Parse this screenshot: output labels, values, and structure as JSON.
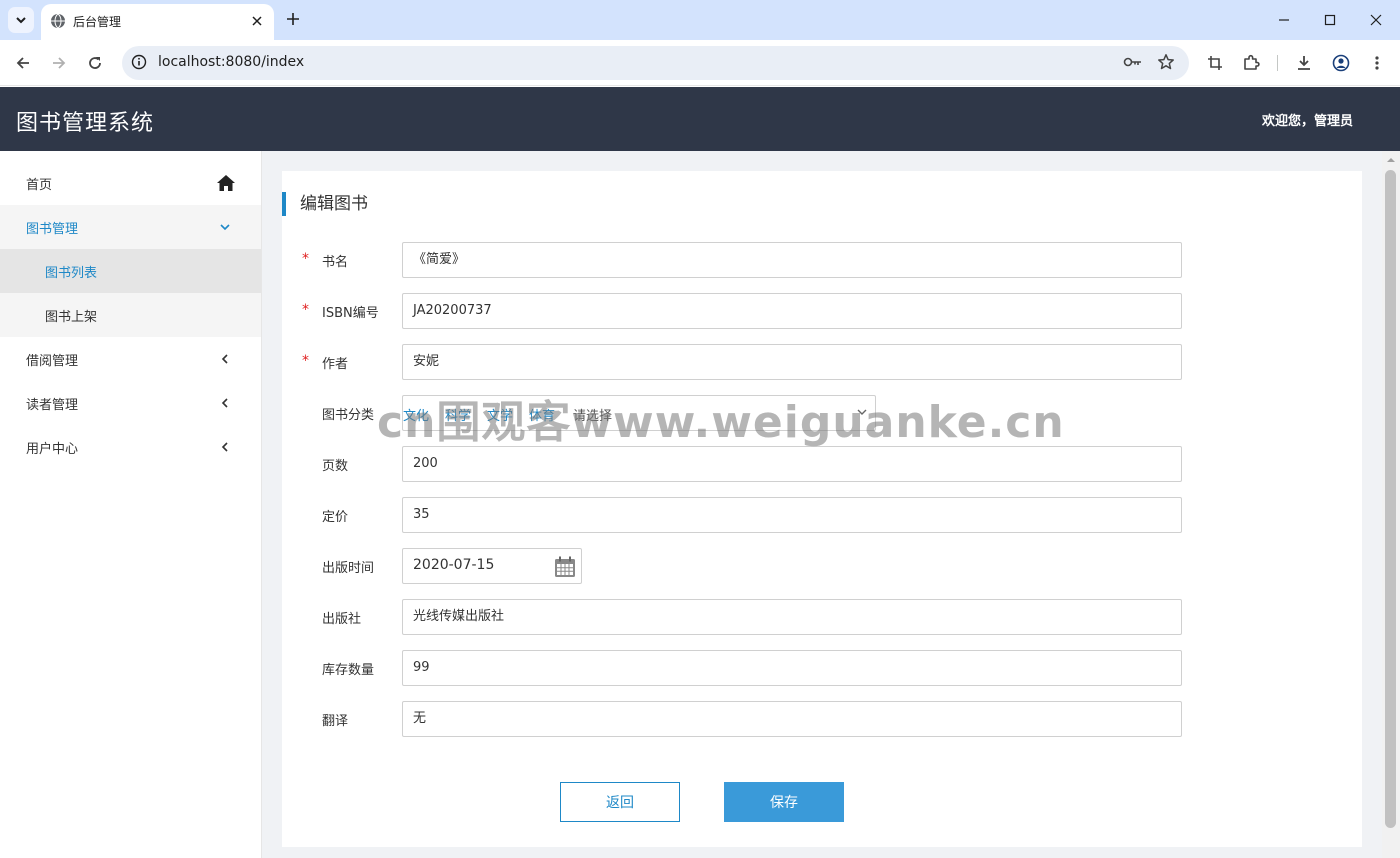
{
  "browser": {
    "tab_title": "后台管理",
    "url": "localhost:8080/index"
  },
  "header": {
    "app_title": "图书管理系统",
    "welcome": "欢迎您，管理员"
  },
  "sidebar": {
    "items": [
      {
        "label": "首页"
      },
      {
        "label": "图书管理"
      },
      {
        "label": "图书列表"
      },
      {
        "label": "图书上架"
      },
      {
        "label": "借阅管理"
      },
      {
        "label": "读者管理"
      },
      {
        "label": "用户中心"
      }
    ]
  },
  "form": {
    "title": "编辑图书",
    "required_mark": "*",
    "fields": {
      "name": {
        "label": "书名",
        "value": "《简爱》"
      },
      "isbn": {
        "label": "ISBN编号",
        "value": "JA20200737"
      },
      "author": {
        "label": "作者",
        "value": "安妮"
      },
      "category": {
        "label": "图书分类",
        "options": [
          "文化",
          "科学",
          "文学",
          "体育"
        ],
        "placeholder": "请选择"
      },
      "pages": {
        "label": "页数",
        "value": "200"
      },
      "price": {
        "label": "定价",
        "value": "35"
      },
      "pub_date": {
        "label": "出版时间",
        "value": "2020-07-15"
      },
      "publisher": {
        "label": "出版社",
        "value": "光线传媒出版社"
      },
      "stock": {
        "label": "库存数量",
        "value": "99"
      },
      "translator": {
        "label": "翻译",
        "value": "无"
      }
    },
    "back_label": "返回",
    "save_label": "保存"
  },
  "watermark": "cn围观客www.weiguanke.cn",
  "colors": {
    "header_bg": "#2f3748",
    "accent": "#1e88c7",
    "save_button": "#3a9ad9",
    "required": "#e02020"
  }
}
